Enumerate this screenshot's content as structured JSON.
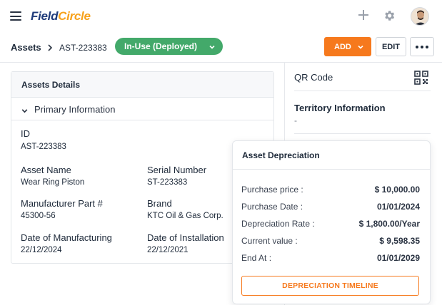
{
  "app": {
    "logo_main": "Field",
    "logo_accent": "Circle",
    "colors": {
      "brand": "#1f3b7a",
      "accent": "#f6791d",
      "status": "#43a96a"
    },
    "icons": [
      "menu-icon",
      "plus-icon",
      "gear-icon",
      "avatar",
      "chevron-right-icon",
      "chevron-down-icon",
      "more-icon",
      "qr-code-icon"
    ]
  },
  "breadcrumb": {
    "root": "Assets",
    "current": "AST-223383"
  },
  "status": {
    "label": "In-Use (Deployed)"
  },
  "actions": {
    "add_label": "ADD",
    "edit_label": "EDIT"
  },
  "details": {
    "title": "Assets Details",
    "section_title": "Primary Information",
    "fields": {
      "id": {
        "label": "ID",
        "value": "AST-223383"
      },
      "asset_name": {
        "label": "Asset Name",
        "value": "Wear Ring Piston"
      },
      "serial_number": {
        "label": "Serial Number",
        "value": "ST-223383"
      },
      "manufacturer_part": {
        "label": "Manufacturer Part #",
        "value": "45300-56"
      },
      "brand": {
        "label": "Brand",
        "value": "KTC Oil & Gas Corp."
      },
      "date_of_manufacturing": {
        "label": "Date of Manufacturing",
        "value": "22/12/2024"
      },
      "date_of_installation": {
        "label": "Date of Installation",
        "value": "22/12/2021"
      }
    }
  },
  "side": {
    "qr_label": "QR Code",
    "territory_label": "Territory Information",
    "territory_value": "-"
  },
  "depreciation": {
    "title": "Asset Depreciation",
    "rows": [
      {
        "label": "Purchase price :",
        "value": "$ 10,000.00"
      },
      {
        "label": "Purchase Date :",
        "value": "01/01/2024"
      },
      {
        "label": "Depreciation Rate :",
        "value": "$ 1,800.00/Year"
      },
      {
        "label": "Current value :",
        "value": "$ 9,598.35"
      },
      {
        "label": "End At :",
        "value": "01/01/2029"
      }
    ],
    "button_label": "DEPRECIATION TIMELINE"
  }
}
